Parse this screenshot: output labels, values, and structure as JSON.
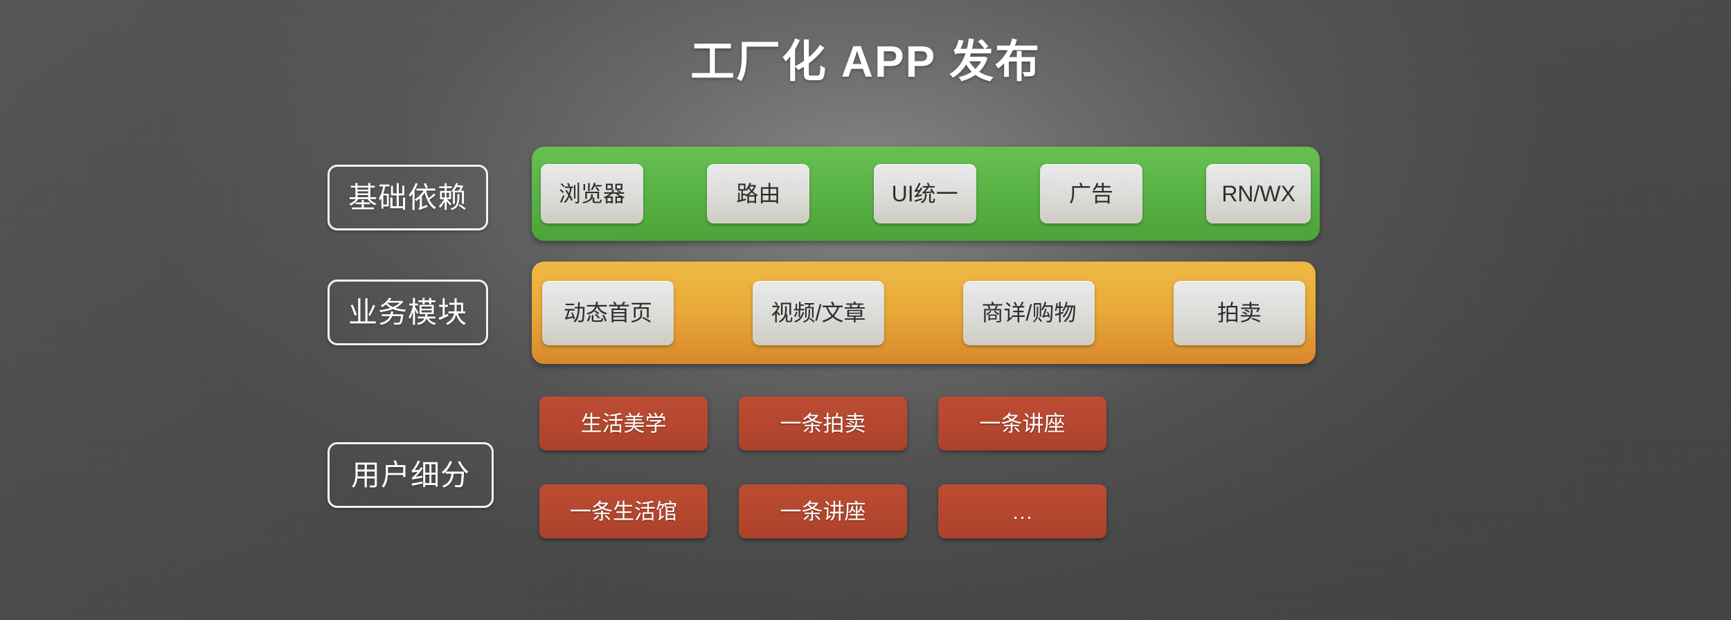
{
  "slide": {
    "title": "工厂化 APP 发布",
    "background_color": "#4a4a4a"
  },
  "categories": [
    {
      "id": "basic",
      "label": "基础依赖"
    },
    {
      "id": "business",
      "label": "业务模块"
    },
    {
      "id": "user",
      "label": "用户细分"
    }
  ],
  "rows": {
    "basic": {
      "band_color": "#58b244",
      "chips": [
        {
          "label": "浏览器"
        },
        {
          "label": "路由"
        },
        {
          "label": "UI统一"
        },
        {
          "label": "广告"
        },
        {
          "label": "RN/WX"
        }
      ]
    },
    "business": {
      "band_color": "#e8a939",
      "chips": [
        {
          "label": "动态首页"
        },
        {
          "label": "视频/文章"
        },
        {
          "label": "商详/购物"
        },
        {
          "label": "拍卖"
        }
      ]
    },
    "user": {
      "box_color": "#b6472f",
      "boxes": [
        {
          "label": "生活美学"
        },
        {
          "label": "一条拍卖"
        },
        {
          "label": "一条讲座"
        },
        {
          "label": "一条生活馆"
        },
        {
          "label": "一条讲座"
        },
        {
          "label": "…"
        }
      ]
    }
  }
}
